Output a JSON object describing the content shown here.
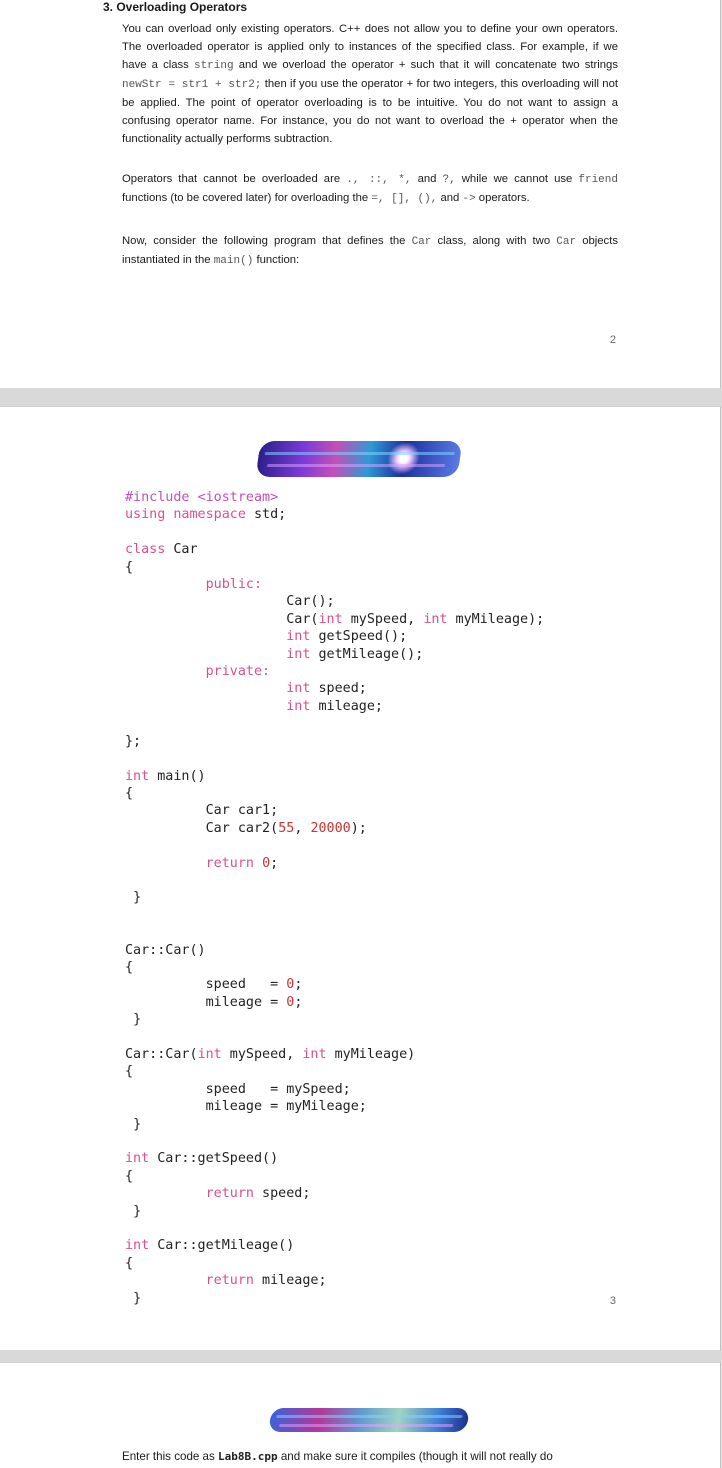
{
  "section": {
    "heading": "3. Overloading Operators"
  },
  "paragraphs": {
    "p1": {
      "a": "You can overload only existing operators. C++ does not allow you to define your own operators. The overloaded operator is applied only to instances of the specified class. For example, if we have a class ",
      "code_string": "string",
      "b": " and we overload the operator + such that it will concatenate two strings ",
      "code_concat": "newStr = str1 + str2;",
      "c": " then if you use the operator + for two integers, this overloading will not be applied. The point of operator overloading is to be intuitive. You do not want to assign a confusing operator name. For instance, you do not want to overload the + operator when the functionality actually performs subtraction."
    },
    "p2": {
      "a": "Operators that cannot be overloaded are ",
      "ops": ".,  ::,  *,",
      "b": " and ",
      "q": "?,",
      "c": " while we cannot use ",
      "friend": "friend",
      "d": " functions (to be covered later) for overloading the ",
      "ops2": "=,  [],  (),",
      "e": " and ",
      "arrow": "->",
      "f": " operators."
    },
    "p3": {
      "a": "Now, consider the following program that defines the ",
      "car1": "Car",
      "b": " class, along with two ",
      "car2": "Car",
      "c": " objects instantiated in the ",
      "main": "main()",
      "d": " function:"
    },
    "p4": {
      "a": "Enter this code as ",
      "file": "Lab8B.cpp",
      "b": " and make sure it compiles (though it will not really do"
    }
  },
  "page_numbers": {
    "page1": "2",
    "page2": "3"
  },
  "code_lines": {
    "l1a": "#include ",
    "l1b": "<iostream>",
    "l2a": "using namespace",
    "l2b": " std;",
    "l4a": "class",
    "l4b": " Car",
    "public": "public:",
    "ctor0": "Car();",
    "ctor1a": "Car(",
    "int": "int",
    "ctor1b": " mySpeed, ",
    "ctor1c": " myMileage);",
    "gs": " getSpeed();",
    "gm": " getMileage();",
    "private": "private:",
    "speed": " speed;",
    "mileage": " mileage;",
    "endclass": "};",
    "main": " main()",
    "car1": "Car car1;",
    "car2a": "Car car2(",
    "n55": "55",
    "comma": ", ",
    "n20000": "20000",
    "car2b": ");",
    "return": "return",
    "zero": "0",
    "semi": ";",
    "ctordef": "Car::Car()",
    "sp_assign": "speed   = ",
    "mi_assign": "mileage = ",
    "ctordef2a": "Car::Car(",
    "ctordef2b": " mySpeed, ",
    "ctordef2c": " myMileage)",
    "sp_assign2": "speed   = mySpeed;",
    "mi_assign2": "mileage = myMileage;",
    "getspeed_def": " Car::getSpeed()",
    "ret_speed": " speed;",
    "getmileage_def": " Car::getMileage()",
    "ret_mileage": " mileage;",
    "ob": "{",
    "cb": "}"
  }
}
